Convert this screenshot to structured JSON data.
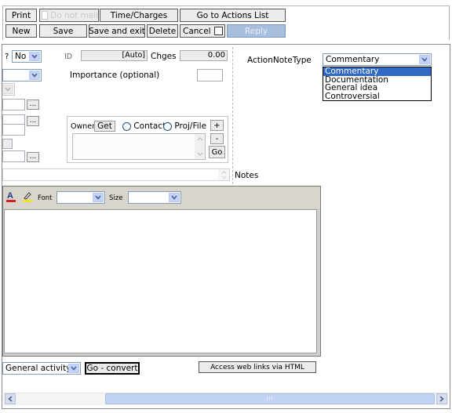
{
  "toolbar": {
    "print": "Print",
    "do_not_mail": "Do not mail",
    "time_charges": "Time/Charges",
    "go_to_actions": "Go to Actions List",
    "new": "New",
    "save": "Save",
    "save_exit": "Save and exit",
    "delete": "Delete",
    "cancel": "Cancel",
    "reply": "Reply"
  },
  "form": {
    "q_label": "?",
    "q_value": "No",
    "id_label": "ID",
    "id_value": "[Auto]",
    "chges_label": "Chges",
    "chges_value": "0.00",
    "importance_label": "Importance (optional)",
    "owner_label": "Owner",
    "get_button": "Get",
    "contact_label": "Contact",
    "projfile_label": "Proj/File",
    "plus": "+",
    "minus": "-",
    "go": "Go",
    "dots": "...",
    "notes_label": "Notes",
    "action_note_type_label": "ActionNoteType",
    "action_note_type_value": "Commentary",
    "action_note_type_options": [
      "Commentary",
      "Documentation",
      "General idea",
      "Controversial"
    ]
  },
  "editor": {
    "font_label": "Font",
    "size_label": "Size"
  },
  "bottom": {
    "activity_value": "General activity",
    "go_convert": "Go - convert",
    "access_links": "Access web links via HTML",
    "scroll_mark": "III"
  }
}
